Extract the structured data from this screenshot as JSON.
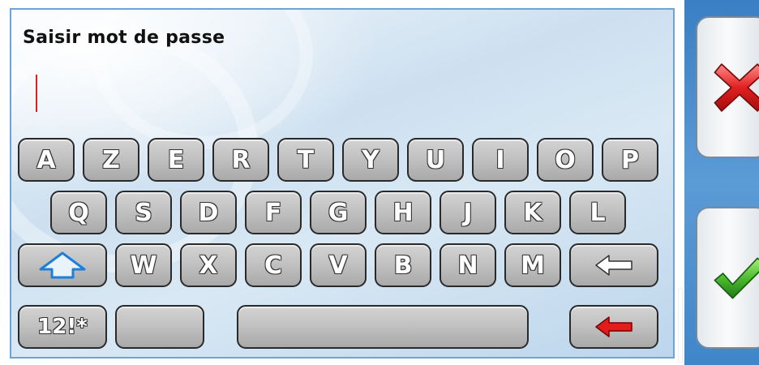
{
  "dialog": {
    "title": "Saisir mot de passe",
    "input_value": ""
  },
  "keyboard": {
    "row1": [
      "A",
      "Z",
      "E",
      "R",
      "T",
      "Y",
      "U",
      "I",
      "O",
      "P"
    ],
    "row2": [
      "Q",
      "S",
      "D",
      "F",
      "G",
      "H",
      "J",
      "K",
      "L"
    ],
    "row3": [
      "W",
      "X",
      "C",
      "V",
      "B",
      "N",
      "M"
    ],
    "shift_icon": "shift-arrow-icon",
    "backspace_icon": "backspace-arrow-icon",
    "symbols_label": "12!*",
    "enter_icon": "red-left-arrow-icon"
  },
  "actions": {
    "cancel_icon": "red-x-icon",
    "confirm_icon": "green-check-icon"
  },
  "colors": {
    "accent_blue": "#3a7fc4",
    "caret_red": "#d22222",
    "cancel_red": "#d62828",
    "confirm_green": "#3aa832"
  }
}
